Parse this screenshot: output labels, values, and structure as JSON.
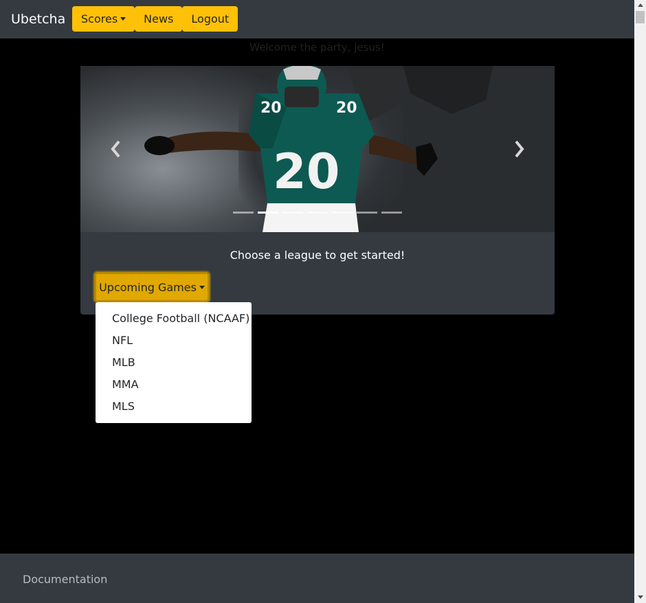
{
  "navbar": {
    "brand": "Ubetcha",
    "items": [
      {
        "label": "Scores",
        "has_caret": true
      },
      {
        "label": "News"
      },
      {
        "label": "Logout"
      }
    ],
    "accent": "#ffc107",
    "background": "#343a40"
  },
  "welcome": "Welcome the party, jesus!",
  "carousel": {
    "prev_icon": "chevron-left-icon",
    "next_icon": "chevron-right-icon",
    "indicator_count": 7,
    "active_indicator": 1
  },
  "card": {
    "text": "Choose a league to get started!",
    "dropdown_label": "Upcoming Games",
    "dropdown_items": [
      "College Football (NCAAF)",
      "NFL",
      "MLB",
      "MMA",
      "MLS"
    ]
  },
  "footer": {
    "link": "Documentation"
  }
}
